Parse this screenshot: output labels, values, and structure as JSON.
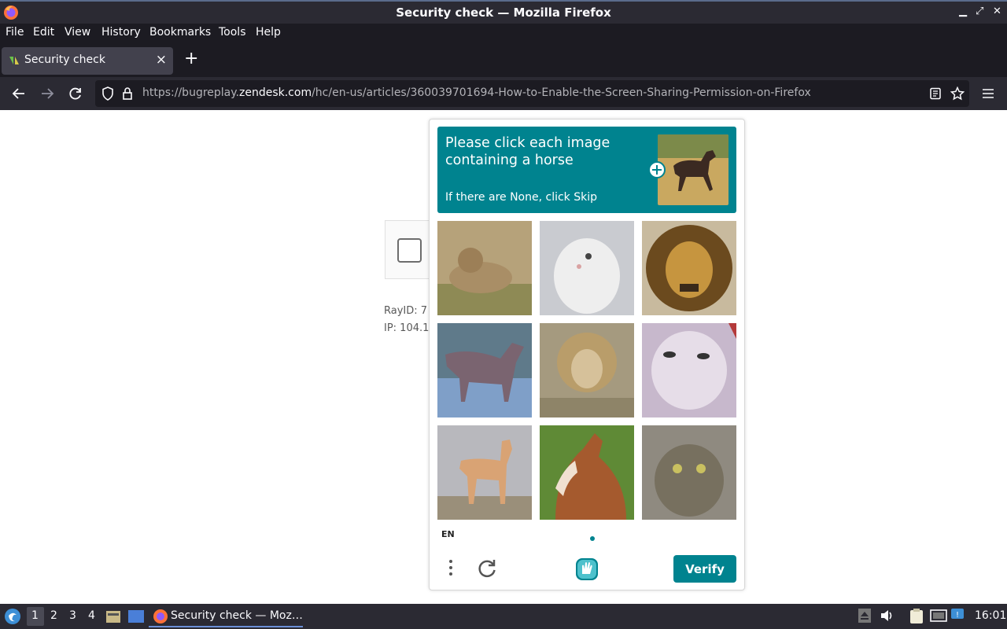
{
  "window": {
    "title": "Security check — Mozilla Firefox"
  },
  "menu": {
    "file": "File",
    "edit": "Edit",
    "view": "View",
    "history": "History",
    "bookmarks": "Bookmarks",
    "tools": "Tools",
    "help": "Help"
  },
  "tab": {
    "title": "Security check",
    "close": "×",
    "new_tab": "+"
  },
  "url": {
    "prefix": "https://bugreplay.",
    "host": "zendesk.com",
    "path": "/hc/en-us/articles/360039701694-How-to-Enable-the-Screen-Sharing-Permission-on-Firefox"
  },
  "page": {
    "ray_id": "RayID: 7",
    "ip": "IP: 104.1"
  },
  "captcha": {
    "prompt_title": "Please click each image containing a horse",
    "prompt_sub": "If there are None, click Skip",
    "example_subject": "horse",
    "images": [
      "lion",
      "cat",
      "lion",
      "horse",
      "lion",
      "cat",
      "horse",
      "horse",
      "cat"
    ],
    "language": "EN",
    "verify_label": "Verify",
    "accent_color": "#00838f"
  },
  "taskbar": {
    "workspaces": [
      "1",
      "2",
      "3",
      "4"
    ],
    "active_workspace": "1",
    "task_title": "Security check — Moz…",
    "clock": "16:01"
  }
}
